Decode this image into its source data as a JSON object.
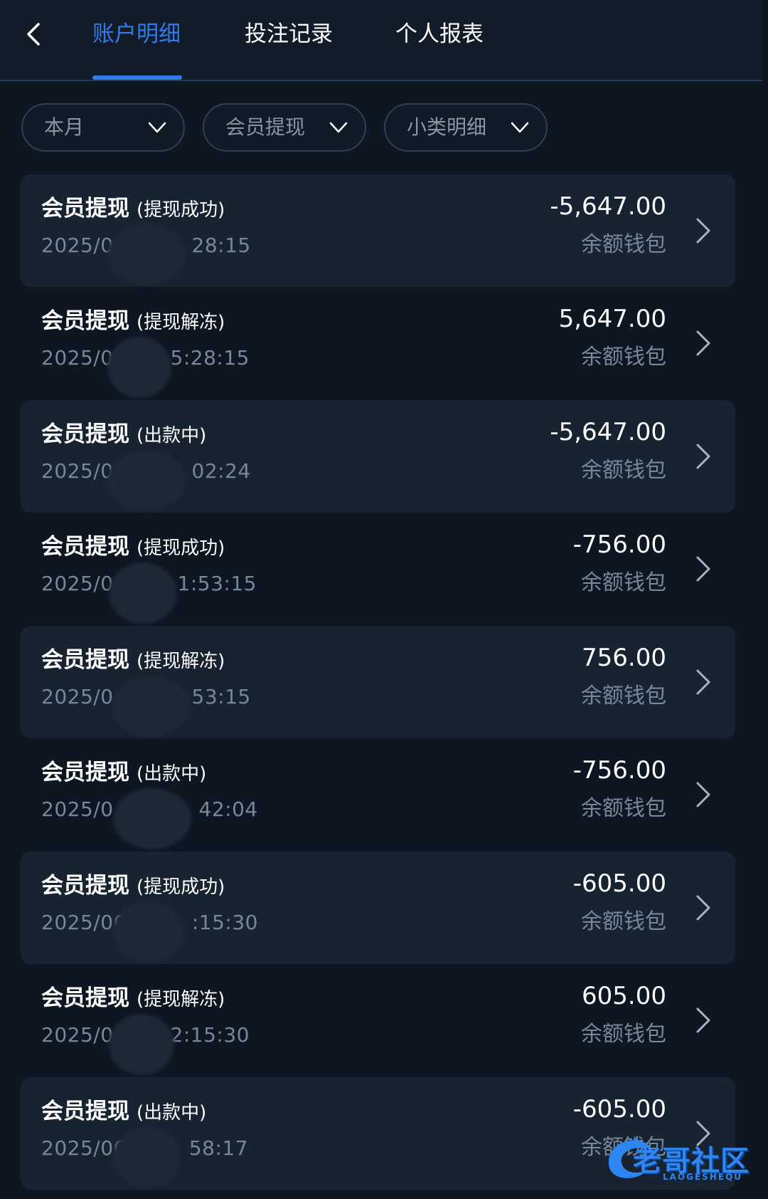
{
  "header": {
    "tabs": [
      {
        "label": "账户明细",
        "active": true
      },
      {
        "label": "投注记录",
        "active": false
      },
      {
        "label": "个人报表",
        "active": false
      }
    ],
    "back_icon": "chevron-left-icon"
  },
  "filters": [
    {
      "label": "本月",
      "icon": "chevron-down-icon"
    },
    {
      "label": "会员提现",
      "icon": "chevron-down-icon"
    },
    {
      "label": "小类明细",
      "icon": "chevron-down-icon"
    }
  ],
  "transactions": [
    {
      "type": "会员提现",
      "status": "(提现成功)",
      "date_prefix": "2025/0",
      "date_suffix": "28:15",
      "amount": "-5,647.00",
      "wallet": "余额钱包"
    },
    {
      "type": "会员提现",
      "status": "(提现解冻)",
      "date_prefix": "2025/0",
      "date_suffix": "5:28:15",
      "amount": "5,647.00",
      "wallet": "余额钱包"
    },
    {
      "type": "会员提现",
      "status": "(出款中)",
      "date_prefix": "2025/0",
      "date_suffix": "02:24",
      "amount": "-5,647.00",
      "wallet": "余额钱包"
    },
    {
      "type": "会员提现",
      "status": "(提现成功)",
      "date_prefix": "2025/0",
      "date_suffix": "1:53:15",
      "amount": "-756.00",
      "wallet": "余额钱包"
    },
    {
      "type": "会员提现",
      "status": "(提现解冻)",
      "date_prefix": "2025/0",
      "date_suffix": "53:15",
      "amount": "756.00",
      "wallet": "余额钱包"
    },
    {
      "type": "会员提现",
      "status": "(出款中)",
      "date_prefix": "2025/0",
      "date_suffix": "42:04",
      "amount": "-756.00",
      "wallet": "余额钱包"
    },
    {
      "type": "会员提现",
      "status": "(提现成功)",
      "date_prefix": "2025/06",
      "date_suffix": ":15:30",
      "amount": "-605.00",
      "wallet": "余额钱包"
    },
    {
      "type": "会员提现",
      "status": "(提现解冻)",
      "date_prefix": "2025/0",
      "date_suffix": "2:15:30",
      "amount": "605.00",
      "wallet": "余额钱包"
    },
    {
      "type": "会员提现",
      "status": "(出款中)",
      "date_prefix": "2025/06",
      "date_suffix": "58:17",
      "amount": "-605.00",
      "wallet": "余额钱包"
    }
  ],
  "watermark": {
    "text": "老哥社区",
    "subtext": "LAOGESHEQU"
  },
  "colors": {
    "accent": "#2f7bea",
    "background": "#0e1622",
    "row_shaded": "#182331",
    "muted_text": "#76879a"
  }
}
